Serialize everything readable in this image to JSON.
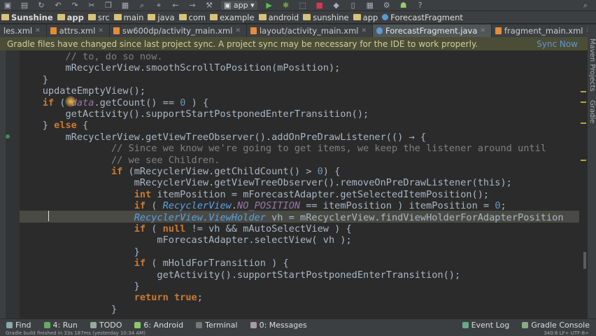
{
  "toolbar": {
    "run_config": "app"
  },
  "breadcrumbs": [
    {
      "label": "Sunshine",
      "bold": true
    },
    {
      "label": "app",
      "bold": true
    },
    {
      "label": "src"
    },
    {
      "label": "main"
    },
    {
      "label": "java"
    },
    {
      "label": "com"
    },
    {
      "label": "example"
    },
    {
      "label": "android"
    },
    {
      "label": "sunshine"
    },
    {
      "label": "app"
    },
    {
      "label": "ForecastFragment"
    }
  ],
  "tabs": [
    {
      "label": "les.xml",
      "type": "xml"
    },
    {
      "label": "attrs.xml",
      "type": "xml"
    },
    {
      "label": "sw600dp/activity_main.xml",
      "type": "xml"
    },
    {
      "label": "layout/activity_main.xml",
      "type": "xml"
    },
    {
      "label": "ForecastFragment.java",
      "type": "java",
      "active": true
    },
    {
      "label": "fragment_main.xml",
      "type": "xml"
    }
  ],
  "banner": {
    "message": "Gradle files have changed since last project sync. A project sync may be necessary for the IDE to work properly.",
    "action": "Sync Now"
  },
  "side_panels": {
    "maven": "Maven Projects",
    "gradle": "Gradle"
  },
  "code_lines": [
    "        // to, do so now.",
    "        mRecyclerView.smoothScrollToPosition(mPosition);",
    "    }",
    "    updateEmptyView();",
    "    if ( data.getCount() == 0 ) {",
    "        getActivity().supportStartPostponedEnterTransition();",
    "    } else {",
    "        mRecyclerView.getViewTreeObserver().addOnPreDrawListener(() → {",
    "                // Since we know we're going to get items, we keep the listener around until",
    "                // we see Children.",
    "                if (mRecyclerView.getChildCount() > 0) {",
    "                    mRecyclerView.getViewTreeObserver().removeOnPreDrawListener(this);",
    "                    int itemPosition = mForecastAdapter.getSelectedItemPosition();",
    "                    if ( RecyclerView.NO_POSITION == itemPosition ) itemPosition = 0;",
    "                    RecyclerView.ViewHolder vh = mRecyclerView.findViewHolderForAdapterPosition",
    "                    if ( null != vh && mAutoSelectView ) {",
    "                        mForecastAdapter.selectView( vh );",
    "                    }",
    "                    if ( mHoldForTransition ) {",
    "                        getActivity().supportStartPostponedEnterTransition();",
    "                    }",
    "                    return true;",
    "                }"
  ],
  "bottom_tools": [
    {
      "label": "Find"
    },
    {
      "label": "4: Run"
    },
    {
      "label": "TODO"
    },
    {
      "label": "6: Android"
    },
    {
      "label": "Terminal"
    },
    {
      "label": "0: Messages"
    }
  ],
  "bottom_right_tools": [
    {
      "label": "Event Log"
    },
    {
      "label": "Gradle Console"
    }
  ],
  "status": {
    "message": "Gradle build finished in 33s 187ms (yesterday 10:34 AM)",
    "position": "340:6   LF÷   UTF-8÷"
  },
  "colors": {
    "background": "#2b2b2b",
    "keyword": "#cc7832",
    "comment": "#808080",
    "number": "#6897bb",
    "field": "#9876aa",
    "banner_bg": "#4c4d36",
    "link": "#5d98d8"
  }
}
